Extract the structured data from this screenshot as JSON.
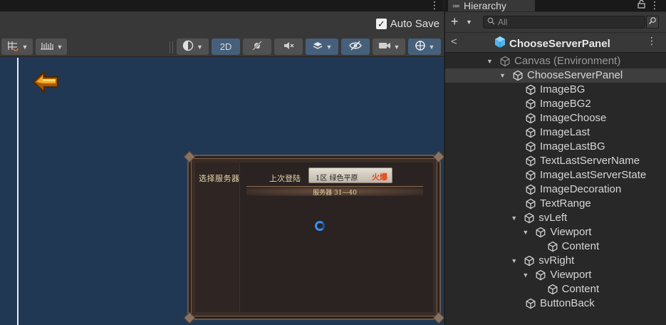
{
  "scene": {
    "menu_dots": "⋮",
    "autosave_label": "Auto Save",
    "autosave_checked": "✓",
    "toolbar": {
      "mode_2d": "2D"
    }
  },
  "game_panel": {
    "choose_title": "选择服务器",
    "last_label": "上次登陆",
    "last_server_name": "1区  绿色平原",
    "last_server_state": "火爆",
    "range_text": "服务器 31—40"
  },
  "hierarchy": {
    "tab_title": "Hierarchy",
    "tab_icon": "≔",
    "lock_icon": "🔒",
    "menu_dots": "⋮",
    "add_icon": "+",
    "search_placeholder": "All",
    "search_icon": "🔍",
    "back_icon": "<",
    "header_title": "ChooseServerPanel",
    "items": [
      {
        "label": "Canvas (Environment)",
        "depth": 0,
        "fold": "▼",
        "kind": "env"
      },
      {
        "label": "ChooseServerPanel",
        "depth": 1,
        "fold": "▼",
        "kind": "selected"
      },
      {
        "label": "ImageBG",
        "depth": 2,
        "fold": "",
        "kind": "normal"
      },
      {
        "label": "ImageBG2",
        "depth": 2,
        "fold": "",
        "kind": "normal"
      },
      {
        "label": "ImageChoose",
        "depth": 2,
        "fold": "",
        "kind": "normal"
      },
      {
        "label": "ImageLast",
        "depth": 2,
        "fold": "",
        "kind": "normal"
      },
      {
        "label": "ImageLastBG",
        "depth": 2,
        "fold": "",
        "kind": "normal"
      },
      {
        "label": "TextLastServerName",
        "depth": 2,
        "fold": "",
        "kind": "normal"
      },
      {
        "label": "ImageLastServerState",
        "depth": 2,
        "fold": "",
        "kind": "normal"
      },
      {
        "label": "ImageDecoration",
        "depth": 2,
        "fold": "",
        "kind": "normal"
      },
      {
        "label": "TextRange",
        "depth": 2,
        "fold": "",
        "kind": "normal"
      },
      {
        "label": "svLeft",
        "depth": 1.9,
        "fold": "▼",
        "kind": "normal"
      },
      {
        "label": "Viewport",
        "depth": 2.8,
        "fold": "▼",
        "kind": "normal"
      },
      {
        "label": "Content",
        "depth": 3.7,
        "fold": "",
        "kind": "normal"
      },
      {
        "label": "svRight",
        "depth": 1.9,
        "fold": "▼",
        "kind": "normal"
      },
      {
        "label": "Viewport",
        "depth": 2.8,
        "fold": "▼",
        "kind": "normal"
      },
      {
        "label": "Content",
        "depth": 3.7,
        "fold": "",
        "kind": "normal"
      },
      {
        "label": "ButtonBack",
        "depth": 2,
        "fold": "",
        "kind": "normal"
      }
    ]
  },
  "colors": {
    "scene_bg": "#213854",
    "selected_row": "#3e3e3e",
    "accent_blue": "#46607c",
    "hot_state": "#e8400c"
  }
}
